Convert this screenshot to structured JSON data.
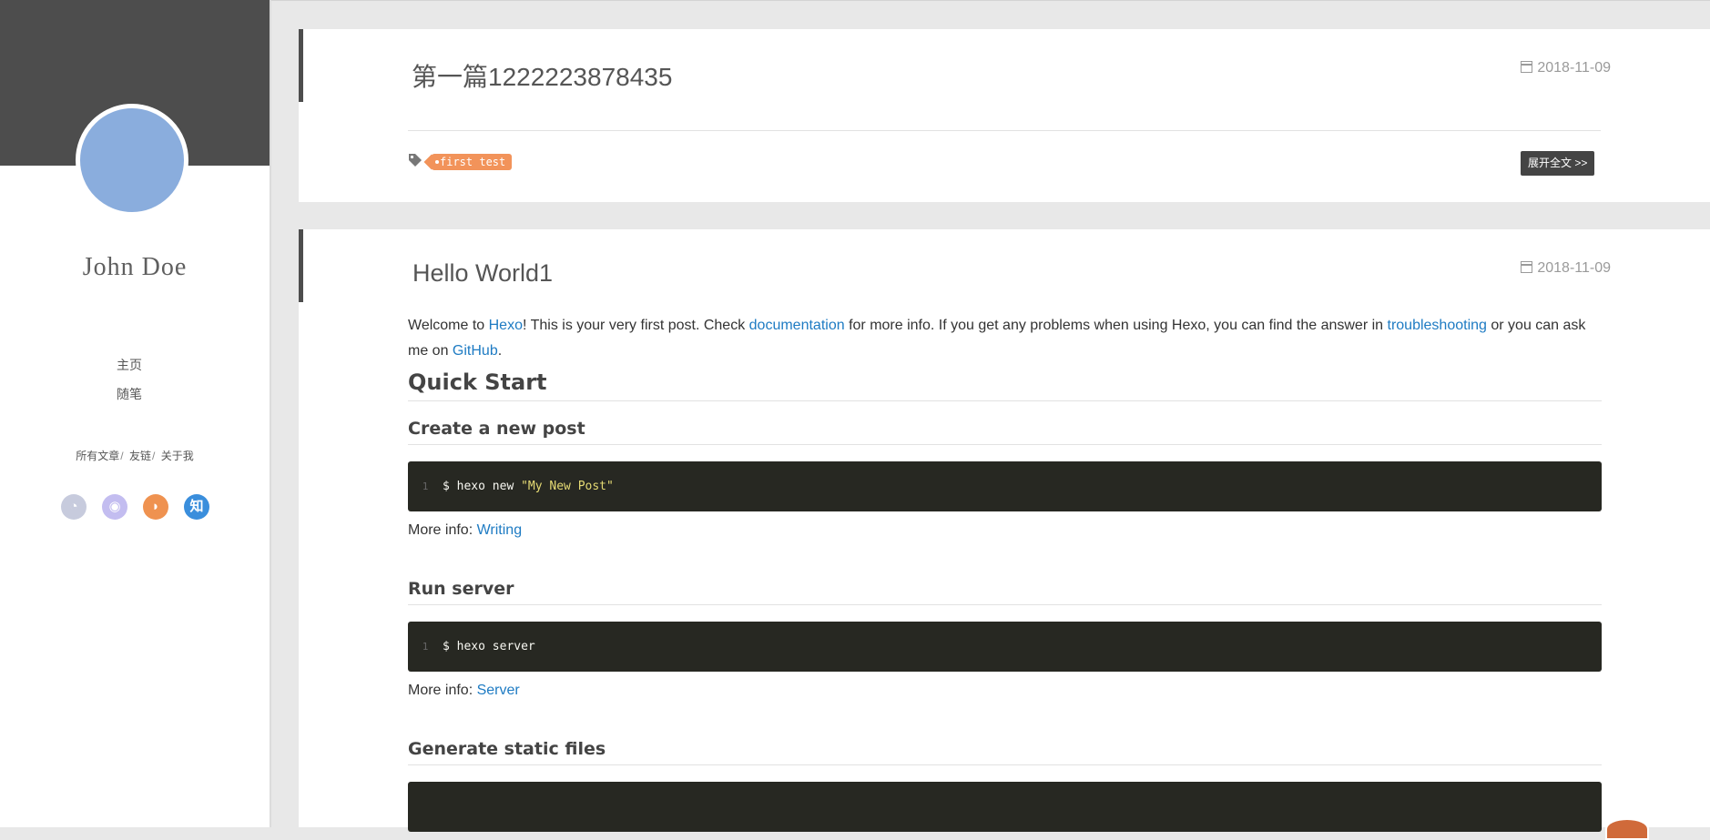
{
  "sidebar": {
    "author": "John Doe",
    "nav": [
      "主页",
      "随笔"
    ],
    "sublinks": [
      "所有文章",
      "友链",
      "关于我"
    ],
    "social": [
      {
        "icon": "github-icon",
        "glyph": "◔",
        "color": "#c7cbdd"
      },
      {
        "icon": "weibo-icon",
        "glyph": "◉",
        "color": "#c3bdf0"
      },
      {
        "icon": "rss-icon",
        "glyph": "◗",
        "color": "#ef9250"
      },
      {
        "icon": "zhihu-icon",
        "glyph": "知",
        "color": "#3a8edc"
      }
    ],
    "colors": {
      "banner": "#4d4d4d",
      "avatar": "#8aaddd"
    }
  },
  "posts": [
    {
      "title": "第一篇1222223878435",
      "date": "2018-11-09",
      "tag": "first test",
      "more_label": "展开全文 >>"
    },
    {
      "title": "Hello World1",
      "date": "2018-11-09",
      "intro": {
        "t1": "Welcome to ",
        "l1": "Hexo",
        "t2": "! This is your very first post. Check ",
        "l2": "documentation",
        "t3": " for more info. If you get any problems when using Hexo, you can find the answer in ",
        "l3": "troubleshooting",
        "t4": " or you can ask me on ",
        "l4": "GitHub",
        "t5": "."
      },
      "h_quick_start": "Quick Start",
      "sections": [
        {
          "heading": "Create a new post",
          "line_no": "1",
          "cmd": "$ hexo new ",
          "cmd_str": "\"My New Post\"",
          "info_label": "More info: ",
          "info_link": "Writing"
        },
        {
          "heading": "Run server",
          "line_no": "1",
          "cmd": "$ hexo server",
          "cmd_str": "",
          "info_label": "More info: ",
          "info_link": "Server"
        },
        {
          "heading": "Generate static files"
        }
      ]
    }
  ],
  "colors": {
    "link": "#1e7bc3",
    "tag": "#f2935a",
    "code_bg": "#272822",
    "code_string": "#e6db74"
  }
}
